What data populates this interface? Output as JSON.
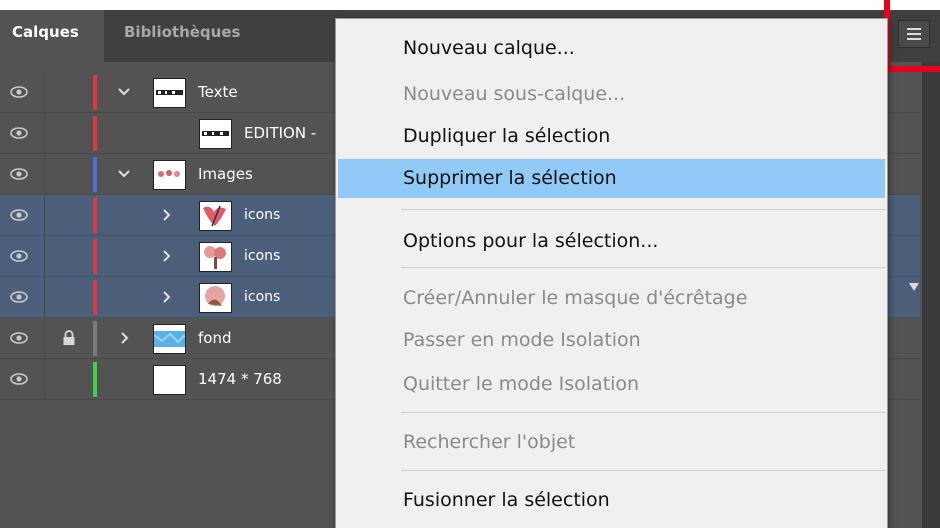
{
  "tabs": {
    "active": "Calques",
    "inactive": "Bibliothèques"
  },
  "layers": [
    {
      "name": "Texte",
      "expanded": true,
      "color": "#e0373f",
      "selected": false,
      "locked": false
    },
    {
      "name": "EDITION -",
      "color": "#e0373f",
      "selected": false,
      "locked": false,
      "sub": true
    },
    {
      "name": "Images",
      "expanded": true,
      "color": "#4b6fe0",
      "selected": false,
      "locked": false
    },
    {
      "name": "icons",
      "color": "#e0373f",
      "selected": true,
      "locked": false
    },
    {
      "name": "icons",
      "color": "#e0373f",
      "selected": true,
      "locked": false
    },
    {
      "name": "icons",
      "color": "#e0373f",
      "selected": true,
      "locked": false
    },
    {
      "name": "fond",
      "color": "#7a7a7a",
      "selected": false,
      "locked": true
    },
    {
      "name": "1474 * 768",
      "color": "#3cd24a",
      "selected": false,
      "locked": false
    }
  ],
  "menu": {
    "items": [
      {
        "label": "Nouveau calque...",
        "disabled": false
      },
      {
        "label": "Nouveau sous-calque...",
        "disabled": true
      },
      {
        "label": "Dupliquer la sélection",
        "disabled": false
      },
      {
        "label": "Supprimer la sélection",
        "disabled": false,
        "highlighted": true
      },
      {
        "label": "Options pour la sélection...",
        "disabled": false
      },
      {
        "label": "Créer/Annuler le masque d'écrêtage",
        "disabled": true
      },
      {
        "label": "Passer en mode Isolation",
        "disabled": true
      },
      {
        "label": "Quitter le mode Isolation",
        "disabled": true
      },
      {
        "label": "Rechercher l'objet",
        "disabled": true
      },
      {
        "label": "Fusionner la sélection",
        "disabled": false
      }
    ]
  },
  "colors": {
    "highlight": "#91c9f7",
    "selection_row": "#4c5f7a",
    "annotation_red": "#e8001c"
  },
  "icons": [
    "eye-icon",
    "lock-icon",
    "chevron-down-icon",
    "chevron-right-icon",
    "panel-menu-icon"
  ]
}
